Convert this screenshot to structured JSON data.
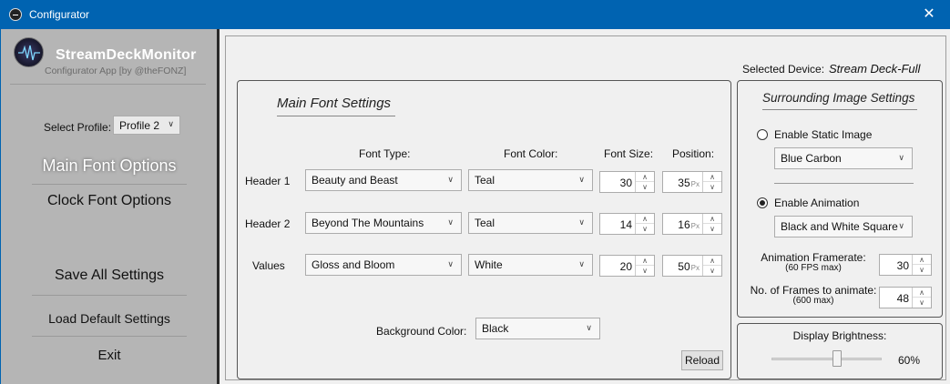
{
  "window": {
    "title": "Configurator",
    "close_glyph": "✕"
  },
  "sidebar": {
    "brand_title": "StreamDeckMonitor",
    "brand_subtitle": "Configurator App [by @theFONZ]",
    "profile_label": "Select Profile:",
    "profile_value": "Profile 2",
    "nav": {
      "main_font": "Main Font Options",
      "clock_font": "Clock Font Options",
      "save_all": "Save All Settings",
      "load_default": "Load Default Settings",
      "exit": "Exit"
    }
  },
  "device": {
    "label": "Selected Device:",
    "value": "Stream Deck-Full"
  },
  "main_font": {
    "title": "Main Font Settings",
    "columns": {
      "type": "Font Type:",
      "color": "Font Color:",
      "size": "Font Size:",
      "position": "Position:"
    },
    "rows": [
      {
        "label": "Header 1",
        "font_type": "Beauty and Beast",
        "font_color": "Teal",
        "font_size": "30",
        "position": "35",
        "unit": "Px"
      },
      {
        "label": "Header 2",
        "font_type": "Beyond The Mountains",
        "font_color": "Teal",
        "font_size": "14",
        "position": "16",
        "unit": "Px"
      },
      {
        "label": "Values",
        "font_type": "Gloss and Bloom",
        "font_color": "White",
        "font_size": "20",
        "position": "50",
        "unit": "Px"
      }
    ],
    "background_label": "Background Color:",
    "background_value": "Black",
    "reload_label": "Reload"
  },
  "surrounding_image": {
    "title": "Surrounding Image Settings",
    "static_label": "Enable Static Image",
    "static_checked": false,
    "static_value": "Blue Carbon",
    "animation_label": "Enable Animation",
    "animation_checked": true,
    "animation_value": "Black and White Square",
    "framerate_label": "Animation Framerate:",
    "framerate_note": "(60 FPS max)",
    "framerate_value": "30",
    "frames_label": "No. of Frames to animate:",
    "frames_note": "(600 max)",
    "frames_value": "48"
  },
  "brightness": {
    "label": "Display Brightness:",
    "value_text": "60%",
    "level": 0.6
  },
  "colors": {
    "titlebar": "#0063b1",
    "sidebar": "#b5b5b5",
    "panel_border": "#555555"
  }
}
